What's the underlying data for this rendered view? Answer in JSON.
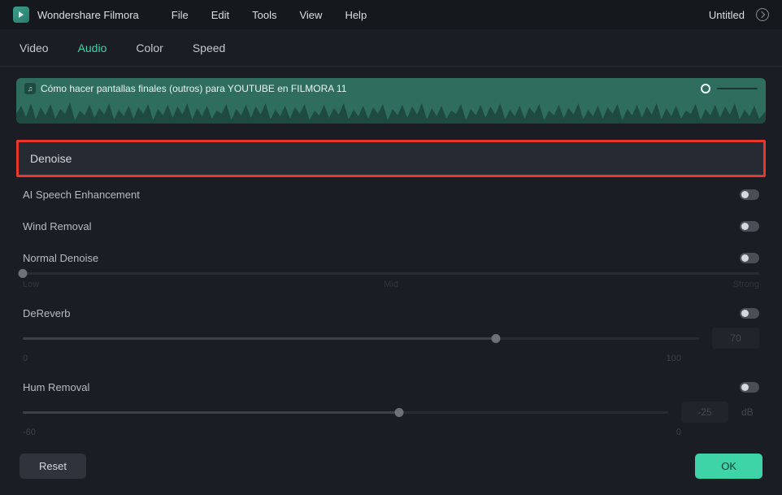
{
  "app": {
    "name": "Wondershare Filmora",
    "project": "Untitled"
  },
  "menu": {
    "file": "File",
    "edit": "Edit",
    "tools": "Tools",
    "view": "View",
    "help": "Help"
  },
  "tabs": {
    "video": "Video",
    "audio": "Audio",
    "color": "Color",
    "speed": "Speed"
  },
  "clip": {
    "title": "Cómo hacer pantallas finales (outros) para YOUTUBE en FILMORA 11"
  },
  "section": {
    "denoise": "Denoise"
  },
  "settings": {
    "ai_speech": {
      "label": "AI Speech Enhancement"
    },
    "wind_removal": {
      "label": "Wind Removal"
    },
    "normal_denoise": {
      "label": "Normal Denoise",
      "low": "Low",
      "mid": "Mid",
      "strong": "Strong"
    },
    "dereverb": {
      "label": "DeReverb",
      "min": "0",
      "max": "100",
      "value": "70"
    },
    "hum_removal": {
      "label": "Hum Removal",
      "min": "-60",
      "max": "0",
      "value": "-25",
      "unit": "dB"
    }
  },
  "buttons": {
    "reset": "Reset",
    "ok": "OK"
  }
}
